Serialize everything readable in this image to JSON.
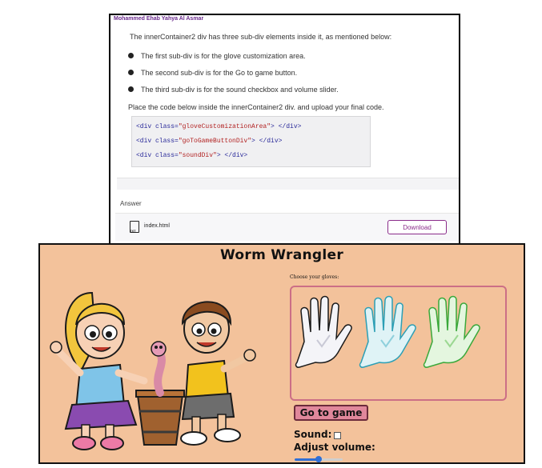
{
  "assignment": {
    "author": "Mohammed Ehab Yahya Al Asmar",
    "intro": "The  innerContainer2  div has  three sub-div elements inside it, as mentioned below:",
    "bullets": [
      "The first sub-div is for the glove customization area.",
      "The second sub-div is for the  Go to game  button.",
      "The third sub-div is for the sound checkbox and volume slider."
    ],
    "instruction": "Place the code below inside the  innerContainer2  div. and upload your final code.",
    "code": {
      "line1_pre": "<div class=",
      "line1_str": "\"gloveCustomizationArea\"",
      "line1_post": "> </div>",
      "line2_pre": "<div class=",
      "line2_str": "\"goToGameButtonDiv\"",
      "line2_post": "> </div>",
      "line3_pre": "<div class=",
      "line3_str": "\"soundDiv\"",
      "line3_post": "> </div>"
    },
    "answer_label": "Answer",
    "file_name": "index.html",
    "file_icon": "txt-file-icon",
    "download_label": "Download"
  },
  "game": {
    "title": "Worm Wrangler",
    "choose_label": "Choose your gloves:",
    "gloves": [
      {
        "name": "white",
        "fill": "#f4f4f8",
        "shade": "#c9c9d6"
      },
      {
        "name": "blue",
        "fill": "#dff3f6",
        "shade": "#8fd0dc"
      },
      {
        "name": "green",
        "fill": "#e4f6df",
        "shade": "#9bd892"
      }
    ],
    "go_button": "Go to game",
    "sound_label": "Sound:",
    "sound_checked": false,
    "volume_label": "Adjust volume:",
    "volume_level": 0.5,
    "colors": {
      "background": "#f3c29b",
      "glove_border": "#cc6f86",
      "button_bg": "#e0879b",
      "accent_purple": "#8a2c8a"
    }
  }
}
